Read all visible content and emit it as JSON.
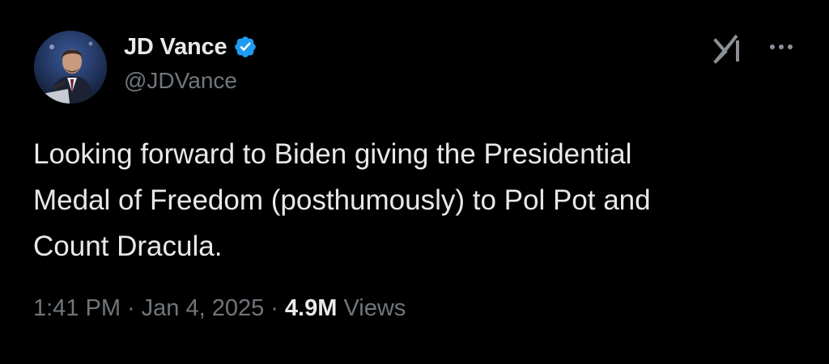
{
  "author": {
    "name": "JD Vance",
    "handle": "@JDVance",
    "verified_color": "#1d9bf0"
  },
  "icons": {
    "verified": "verified-badge-icon",
    "grok": "grok-icon",
    "more": "more-options-icon"
  },
  "tweet": {
    "text_lines": [
      "Looking forward to Biden giving the Presidential",
      "Medal of Freedom (posthumously) to Pol Pot and",
      "Count Dracula."
    ],
    "time": "1:41 PM",
    "date": "Jan 4, 2025",
    "separator": "·",
    "views_count": "4.9M",
    "views_label": "Views"
  },
  "colors": {
    "background": "#000000",
    "primary_text": "#e7e9ea",
    "secondary_text": "#71767b"
  }
}
